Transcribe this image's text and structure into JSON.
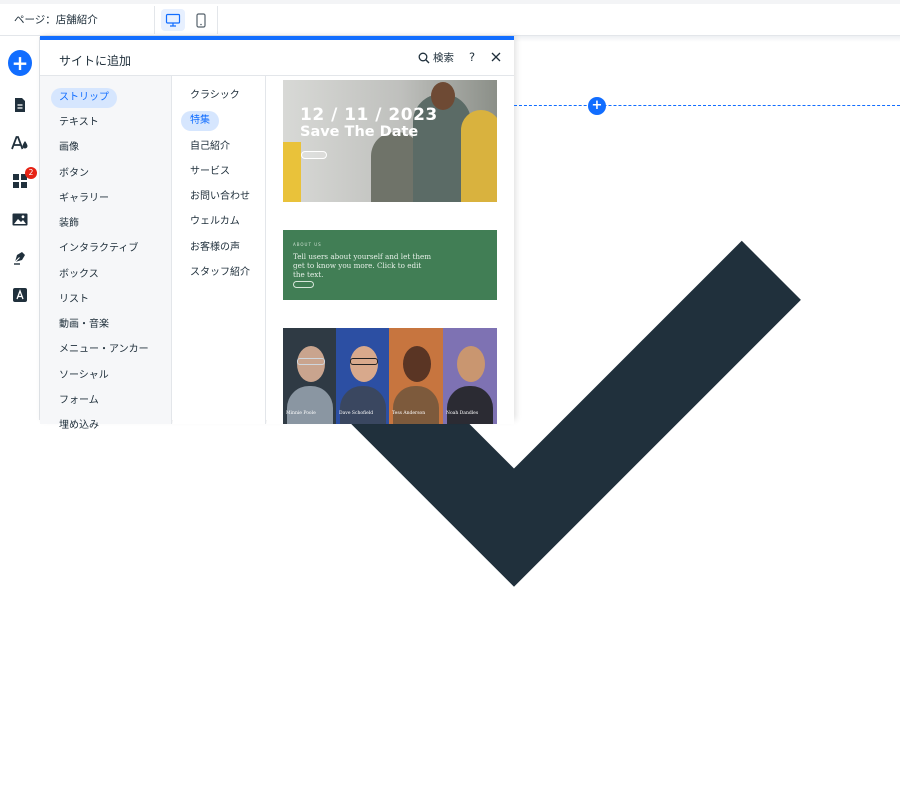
{
  "topbar": {
    "page_label": "ページ：店舗紹介",
    "devices": [
      {
        "icon": "desktop-icon",
        "active": true
      },
      {
        "icon": "mobile-icon",
        "active": false
      }
    ]
  },
  "leftbar": {
    "items": [
      {
        "icon": "add-icon"
      },
      {
        "icon": "pages-icon"
      },
      {
        "icon": "design-icon"
      },
      {
        "icon": "apps-icon",
        "badge": "2"
      },
      {
        "icon": "media-icon"
      },
      {
        "icon": "pen-icon"
      },
      {
        "icon": "text-style-icon"
      }
    ]
  },
  "panel": {
    "title": "サイトに追加",
    "search_label": "検索",
    "help_label": "?",
    "categories": [
      {
        "label": "ストリップ",
        "active": true
      },
      {
        "label": "テキスト"
      },
      {
        "label": "画像"
      },
      {
        "label": "ボタン"
      },
      {
        "label": "ギャラリー"
      },
      {
        "label": "装飾"
      },
      {
        "label": "インタラクティブ"
      },
      {
        "label": "ボックス"
      },
      {
        "label": "リスト"
      },
      {
        "label": "動画・音楽"
      },
      {
        "label": "メニュー・アンカー"
      },
      {
        "label": "ソーシャル"
      },
      {
        "label": "フォーム"
      },
      {
        "label": "埋め込み"
      }
    ],
    "subcategories": [
      {
        "label": "クラシック"
      },
      {
        "label": "特集",
        "active": true
      },
      {
        "label": "自己紹介"
      },
      {
        "label": "サービス"
      },
      {
        "label": "お問い合わせ"
      },
      {
        "label": "ウェルカム"
      },
      {
        "label": "お客様の声"
      },
      {
        "label": "スタッフ紹介"
      }
    ],
    "thumbnails": [
      {
        "date": "12 / 11 / 2023",
        "headline": "Save The Date"
      },
      {
        "eyebrow": "ABOUT US",
        "text": "Tell users about yourself and let them get to know you more. Click to edit the text."
      },
      {
        "names": [
          "Minnie Poole",
          "Dave Schofield",
          "Tess Anderson",
          "Noah Dandles"
        ]
      }
    ]
  },
  "colors": {
    "accent": "#116dff",
    "badge": "#e62214",
    "green_strip": "#417e55"
  }
}
